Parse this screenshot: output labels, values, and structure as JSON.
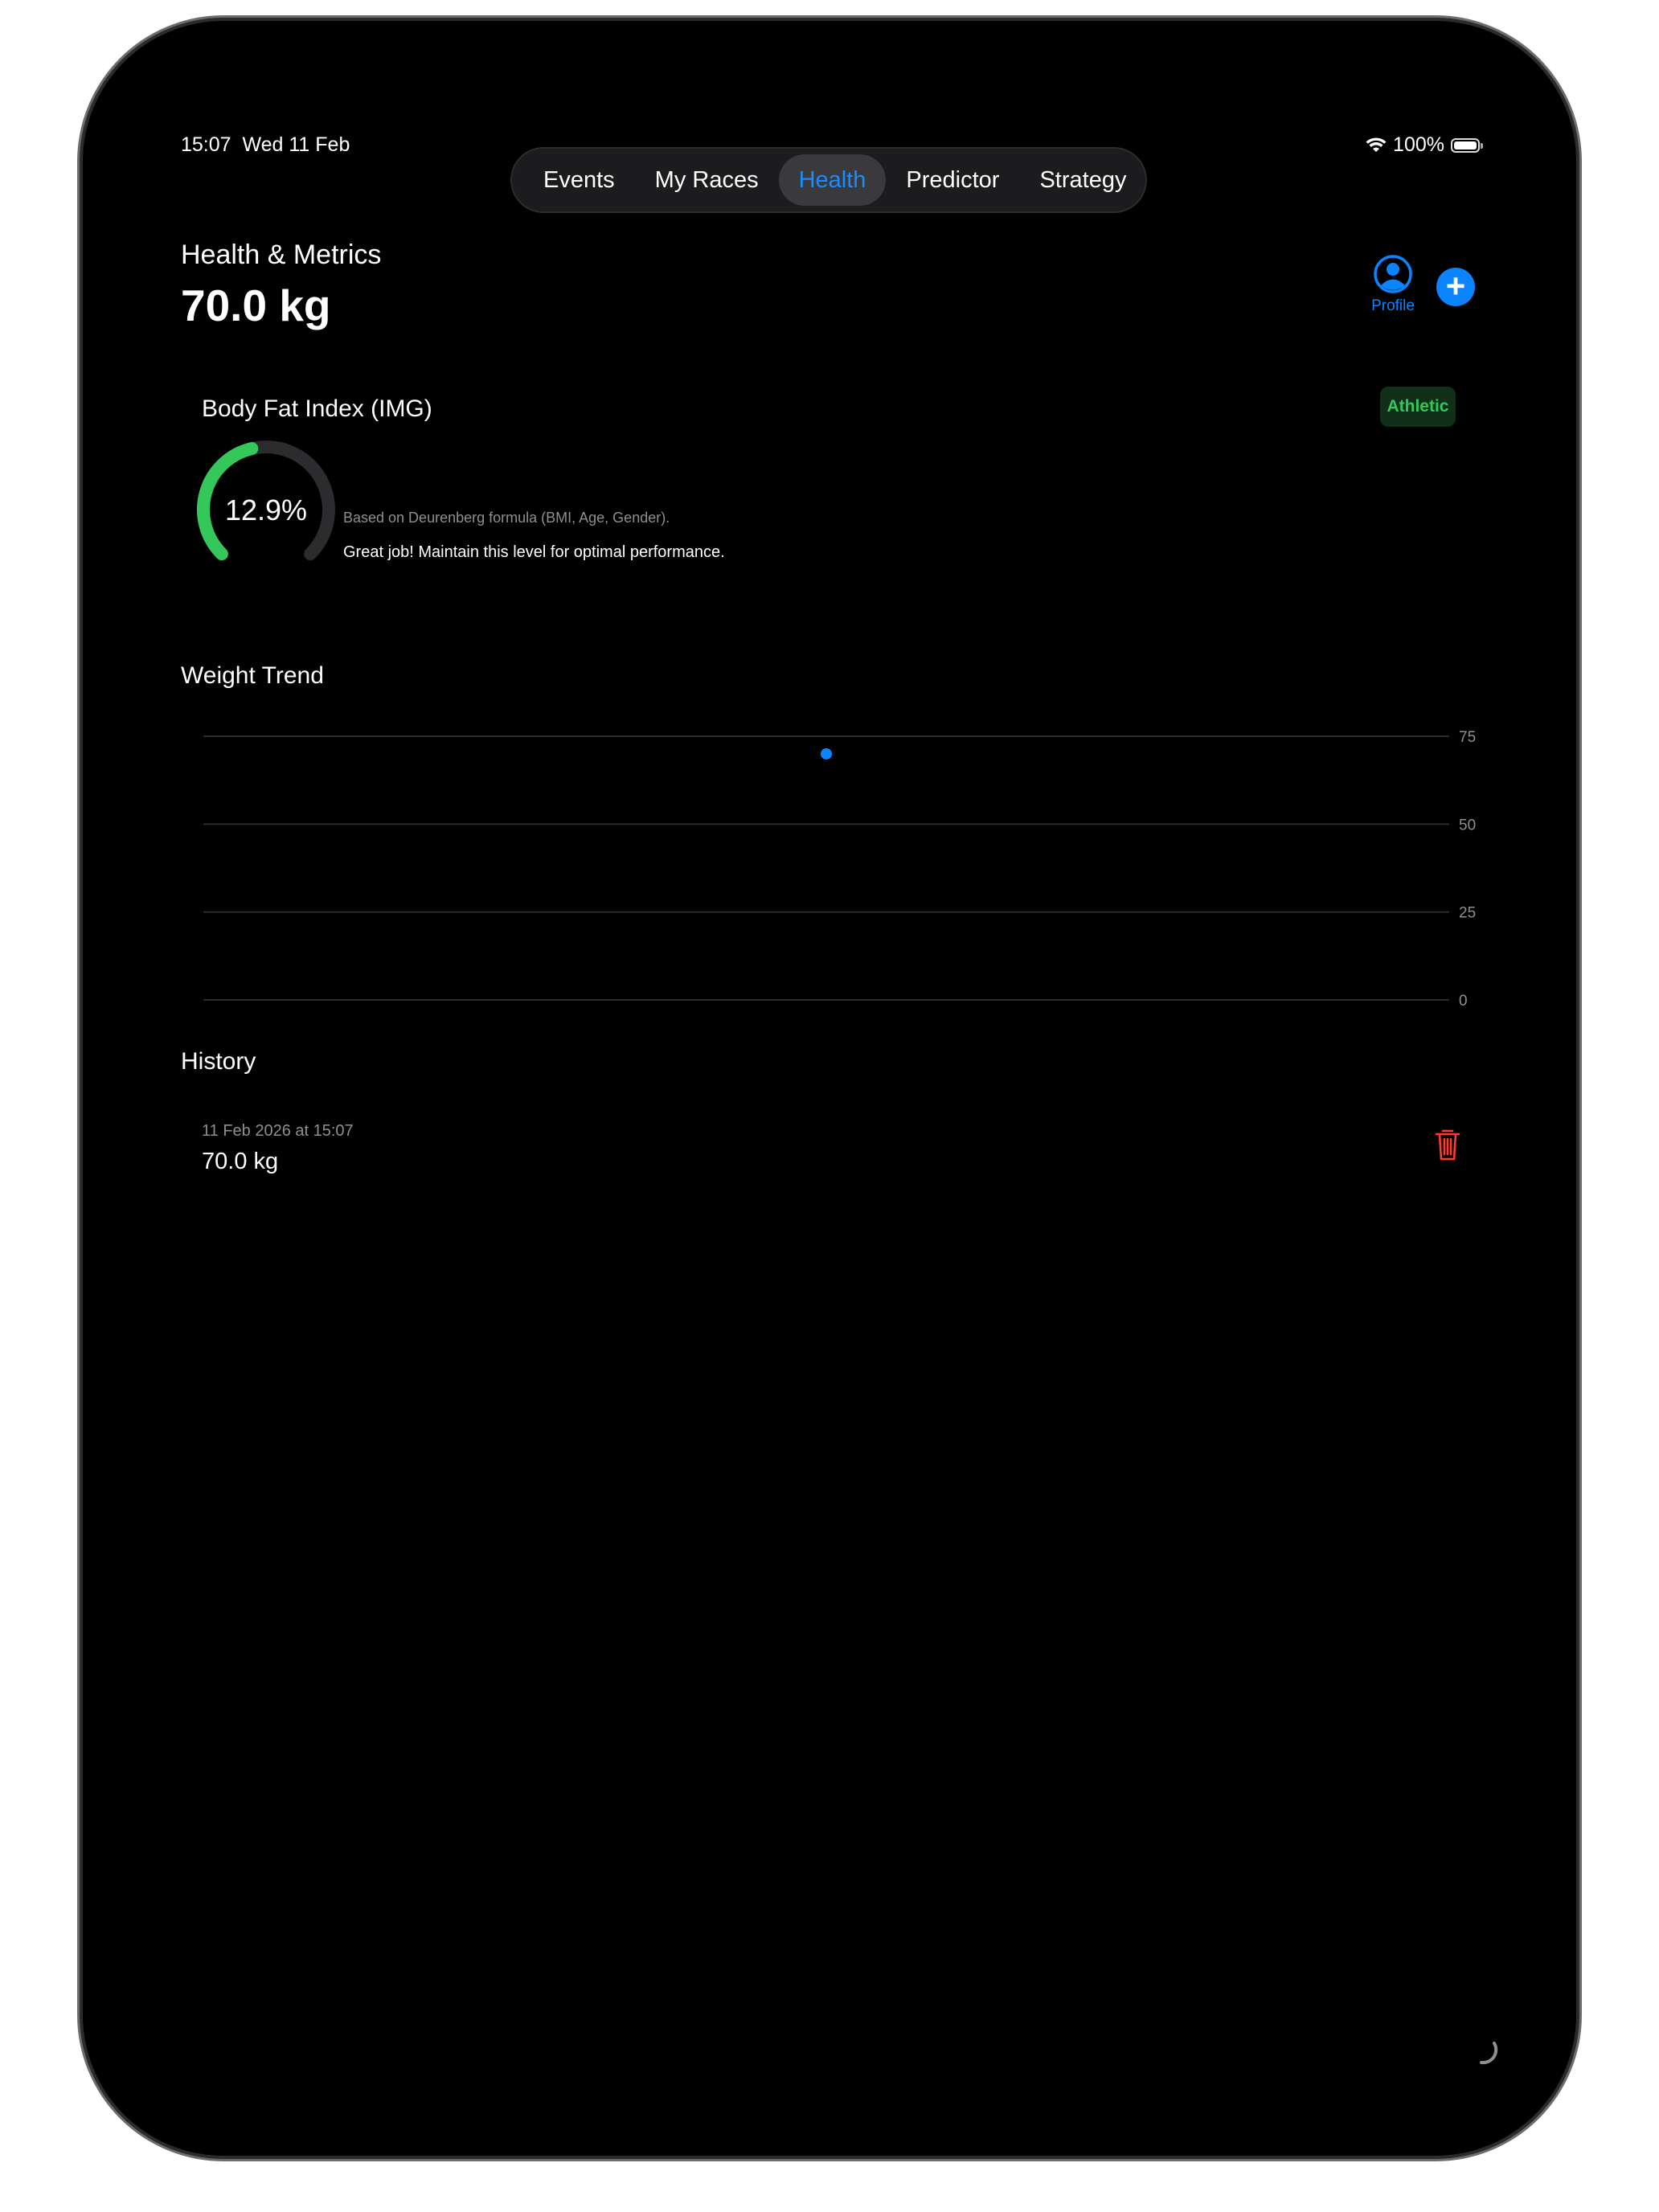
{
  "status": {
    "time": "15:07",
    "date": "Wed 11 Feb",
    "battery": "100%"
  },
  "tabs": [
    {
      "label": "Events"
    },
    {
      "label": "My Races"
    },
    {
      "label": "Health"
    },
    {
      "label": "Predictor"
    },
    {
      "label": "Strategy"
    }
  ],
  "active_tab": "Health",
  "header": {
    "title": "Health & Metrics",
    "weight": "70.0 kg",
    "profile_label": "Profile",
    "add_icon": "plus-circle-icon",
    "profile_icon": "person-circle-icon"
  },
  "body_fat": {
    "title": "Body Fat Index (IMG)",
    "value": "12.9%",
    "fraction": 0.129,
    "badge": "Athletic",
    "formula": "Based on Deurenberg formula (BMI, Age, Gender).",
    "message": "Great job! Maintain this level for optimal performance."
  },
  "weight_trend": {
    "title": "Weight Trend"
  },
  "chart_data": {
    "type": "scatter",
    "title": "Weight Trend",
    "xlabel": "",
    "ylabel": "",
    "ylim": [
      0,
      75
    ],
    "y_ticks": [
      "75",
      "50",
      "25",
      "0"
    ],
    "grid": true,
    "series": [
      {
        "x": [
          "11 Feb 2026 15:07"
        ],
        "values": [
          70.0
        ]
      }
    ]
  },
  "history": {
    "title": "History",
    "entries": [
      {
        "date": "11 Feb 2026 at 15:07",
        "weight": "70.0 kg"
      }
    ]
  },
  "colors": {
    "accent": "#0a84ff",
    "good": "#34c759",
    "danger": "#ff3b30",
    "background": "#000000"
  }
}
